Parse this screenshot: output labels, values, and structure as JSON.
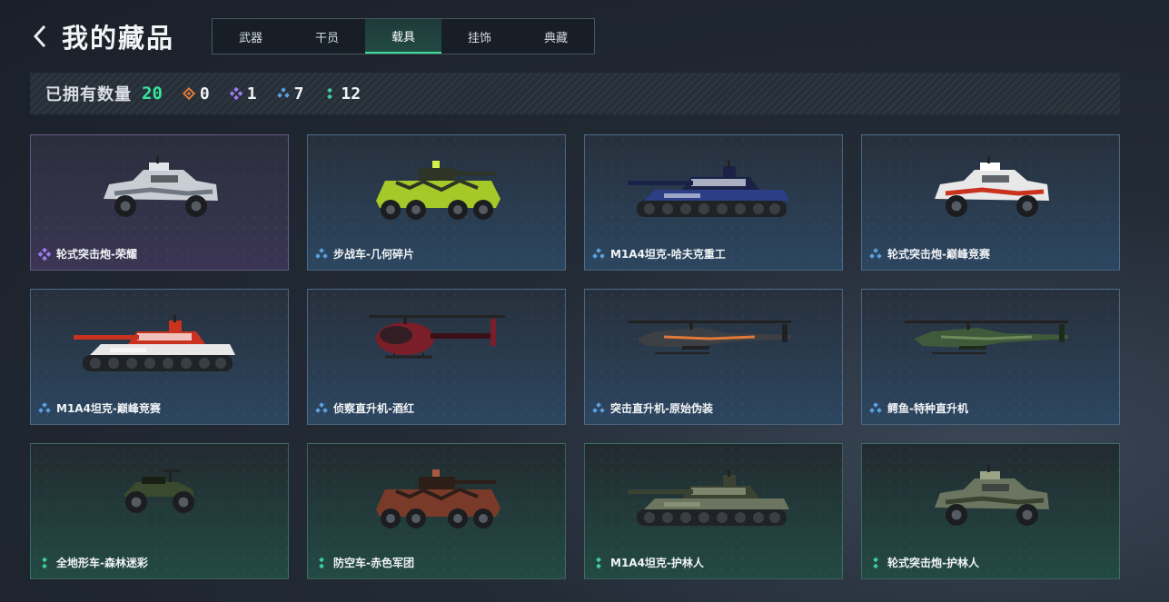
{
  "header": {
    "title": "我的藏品"
  },
  "tabs": [
    {
      "label": "武器",
      "active": false
    },
    {
      "label": "干员",
      "active": false
    },
    {
      "label": "载具",
      "active": true
    },
    {
      "label": "挂饰",
      "active": false
    },
    {
      "label": "典藏",
      "active": false
    }
  ],
  "stats": {
    "label": "已拥有数量",
    "total": "20",
    "counts": [
      {
        "rarity": "orange",
        "icon": "orange-diamond-icon",
        "value": "0"
      },
      {
        "rarity": "purple",
        "icon": "purple-diamond-icon",
        "value": "1"
      },
      {
        "rarity": "blue",
        "icon": "blue-diamond-icon",
        "value": "7"
      },
      {
        "rarity": "green",
        "icon": "green-diamond-icon",
        "value": "12"
      }
    ]
  },
  "colors": {
    "accent": "#35e69a",
    "orange": "#e07a3c",
    "purple": "#9b7cf0",
    "blue": "#5aa0e0",
    "green": "#3dcf9a"
  },
  "items": [
    {
      "name": "轮式突击炮-荣耀",
      "rarity": "purple",
      "kind": "armored-car",
      "paint": "silver"
    },
    {
      "name": "步战车-几何碎片",
      "rarity": "blue",
      "kind": "ifv",
      "paint": "lime"
    },
    {
      "name": "M1A4坦克-哈夫克重工",
      "rarity": "blue",
      "kind": "tank",
      "paint": "navy"
    },
    {
      "name": "轮式突击炮-巅峰竞赛",
      "rarity": "blue",
      "kind": "armored-car",
      "paint": "racing-red"
    },
    {
      "name": "M1A4坦克-巅峰竞赛",
      "rarity": "blue",
      "kind": "tank",
      "paint": "racing-red"
    },
    {
      "name": "侦察直升机-酒红",
      "rarity": "blue",
      "kind": "scout-heli",
      "paint": "wine"
    },
    {
      "name": "突击直升机-原始伪装",
      "rarity": "blue",
      "kind": "attack-heli",
      "paint": "dark-orange"
    },
    {
      "name": "鳄鱼-特种直升机",
      "rarity": "blue",
      "kind": "attack-heli",
      "paint": "green-camo"
    },
    {
      "name": "全地形车-森林迷彩",
      "rarity": "green",
      "kind": "atv",
      "paint": "forest"
    },
    {
      "name": "防空车-赤色军团",
      "rarity": "green",
      "kind": "ifv",
      "paint": "red-camo"
    },
    {
      "name": "M1A4坦克-护林人",
      "rarity": "green",
      "kind": "tank",
      "paint": "woodland"
    },
    {
      "name": "轮式突击炮-护林人",
      "rarity": "green",
      "kind": "armored-car",
      "paint": "woodland"
    }
  ]
}
